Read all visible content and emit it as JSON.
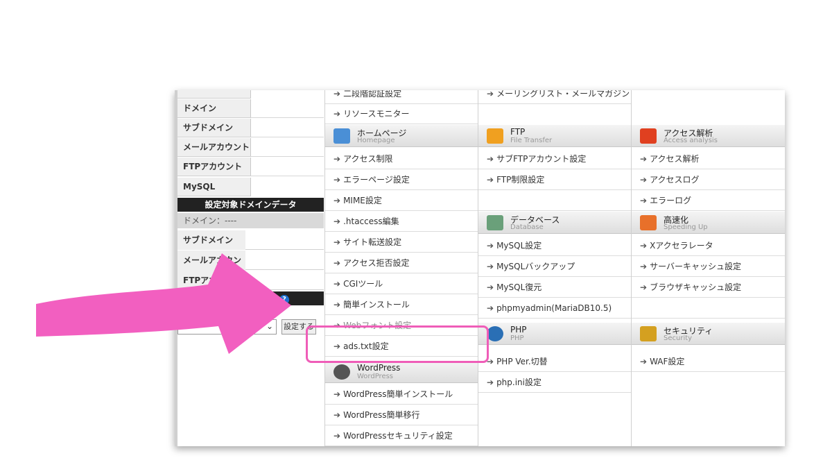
{
  "sidebar": {
    "items": [
      "ドメイン",
      "サブドメイン",
      "メールアカウント",
      "FTPアカウント",
      "MySQL"
    ],
    "domain_data_header": "設定対象ドメインデータ",
    "domain_label": "ドメイン：----",
    "rows": [
      "サブドメイン",
      "メールアカウント",
      "FTPアカウント"
    ],
    "set_button": "設定する"
  },
  "col1": {
    "top_items": [
      "二段階認証設定",
      "リソースモニター"
    ],
    "homepage": {
      "title": "ホームページ",
      "sub": "Homepage"
    },
    "homepage_items": [
      "アクセス制限",
      "エラーページ設定",
      "MIME設定",
      ".htaccess編集",
      "サイト転送設定",
      "アクセス拒否設定",
      "CGIツール",
      "簡単インストール",
      "Webフォント設定",
      "ads.txt設定"
    ],
    "wordpress": {
      "title": "WordPress",
      "sub": "WordPress"
    },
    "wordpress_items": [
      "WordPress簡単インストール",
      "WordPress簡単移行",
      "WordPressセキュリティ設定"
    ]
  },
  "col2": {
    "top_items": [
      "メーリングリスト・メールマガジン"
    ],
    "ftp": {
      "title": "FTP",
      "sub": "File Transfer"
    },
    "ftp_items": [
      "サブFTPアカウント設定",
      "FTP制限設定"
    ],
    "database": {
      "title": "データベース",
      "sub": "Database"
    },
    "database_items": [
      "MySQL設定",
      "MySQLバックアップ",
      "MySQL復元",
      "phpmyadmin(MariaDB10.5)"
    ],
    "php": {
      "title": "PHP",
      "sub": "PHP"
    },
    "php_items": [
      "PHP Ver.切替",
      "php.ini設定"
    ]
  },
  "col3": {
    "access": {
      "title": "アクセス解析",
      "sub": "Access analysis"
    },
    "access_items": [
      "アクセス解析",
      "アクセスログ",
      "エラーログ"
    ],
    "speed": {
      "title": "高速化",
      "sub": "Speeding Up"
    },
    "speed_items": [
      "Xアクセラレータ",
      "サーバーキャッシュ設定",
      "ブラウザキャッシュ設定"
    ],
    "security": {
      "title": "セキュリティ",
      "sub": "Security"
    },
    "security_items": [
      "WAF設定"
    ]
  },
  "colors": {
    "highlight": "#ef5db8",
    "arrow": "#f25fc0"
  }
}
